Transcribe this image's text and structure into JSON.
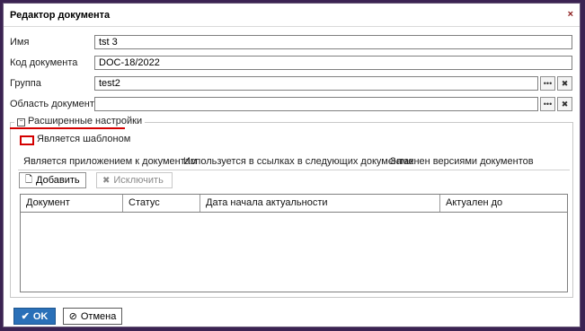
{
  "window": {
    "title": "Редактор документа",
    "close_glyph": "×"
  },
  "fields": {
    "name": {
      "label": "Имя",
      "value": "tst 3"
    },
    "code": {
      "label": "Код документа",
      "value": "DOC-18/2022"
    },
    "group": {
      "label": "Группа",
      "value": "test2"
    },
    "area": {
      "label": "Область документа",
      "value": ""
    }
  },
  "advanced": {
    "legend": "Расширенные настройки",
    "is_template_label": "Является шаблоном",
    "tabs": [
      "Является приложением к документам",
      "Используется в ссылках в следующих документах",
      "Заменен версиями документов"
    ],
    "add_button": "Добавить",
    "remove_button": "Исключить",
    "columns": [
      "Документ",
      "Статус",
      "Дата начала актуальности",
      "Актуален до"
    ]
  },
  "footer": {
    "ok": "OK",
    "cancel": "Отмена"
  },
  "colors": {
    "ok_button": "#2a70b8",
    "highlight": "#d40000"
  },
  "icons": {
    "picker": "ellipsis-icon",
    "clear": "x-icon",
    "add": "document-icon",
    "remove": "x-icon",
    "ok": "check-icon",
    "cancel": "cancel-icon"
  }
}
